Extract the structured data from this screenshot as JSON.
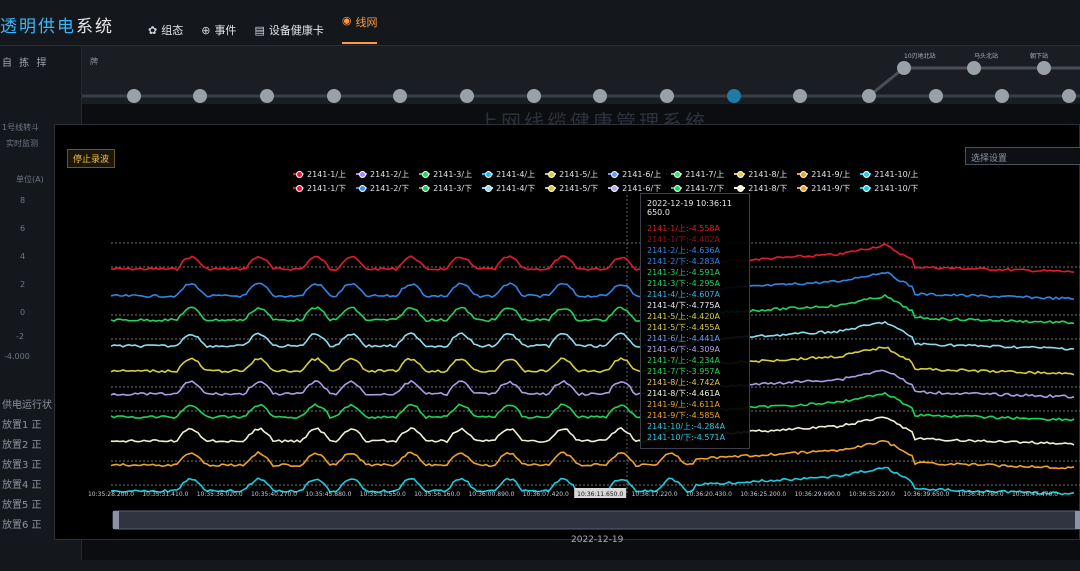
{
  "app": {
    "title_part1": "透明供电",
    "title_part2": "系统"
  },
  "nav": [
    {
      "icon": "gear-icon",
      "glyph": "✿",
      "label": "组态"
    },
    {
      "icon": "globe-icon",
      "glyph": "⊕",
      "label": "事件"
    },
    {
      "icon": "card-icon",
      "glyph": "▤",
      "label": "设备健康卡"
    },
    {
      "icon": "pin-icon",
      "glyph": "◉",
      "label": "线网"
    }
  ],
  "left_panel": {
    "header": "自 拣 捍",
    "sub1": "1号线转斗",
    "sub2": "实时监测",
    "ylabel": "单位(A)",
    "ticks": [
      "8",
      "6",
      "4",
      "2",
      "0",
      "-2",
      "-4.000"
    ],
    "list_header": "供电运行状",
    "list": [
      "放置1 正",
      "放置2 正",
      "放置3 正",
      "放置4 正",
      "放置5 正",
      "放置6 正"
    ]
  },
  "track": {
    "label": "牌",
    "station_names": [
      "10刃地北站",
      "马头北站",
      "朝下站"
    ]
  },
  "bg_title": "上网线缆健康管理系统",
  "popup": {
    "stop_button": "停止录波",
    "select_placeholder": "选择设置",
    "date_label": "2022-12-19"
  },
  "chart_data": {
    "type": "line",
    "x_ticks": [
      "10:35:28.200.0",
      "10:35:31.410.0",
      "10:35:36.020.0",
      "10:35:40.270.0",
      "10:35:45.880.0",
      "10:35:51.550.0",
      "10:35:56.160.0",
      "10:36:00.890.0",
      "10:36:07.420.0",
      "10:36:11.650.0",
      "10:36:17.220.0",
      "10:36:20.430.0",
      "10:36:25.200.0",
      "10:36:29.690.0",
      "10:36:35.220.0",
      "10:36:39.650.0",
      "10:36:43.780.0",
      "10:36:47.470.0"
    ],
    "highlight_tick_index": 9,
    "series": [
      {
        "name": "2141-1/上",
        "color": "#e8192c"
      },
      {
        "name": "2141-2/上",
        "color": "#a58cf0"
      },
      {
        "name": "2141-3/上",
        "color": "#22d35c"
      },
      {
        "name": "2141-4/上",
        "color": "#2fb6e8"
      },
      {
        "name": "2141-5/上",
        "color": "#d8cf3a"
      },
      {
        "name": "2141-6/上",
        "color": "#6a9ee8"
      },
      {
        "name": "2141-7/上",
        "color": "#3ee070"
      },
      {
        "name": "2141-8/上",
        "color": "#e4c65a"
      },
      {
        "name": "2141-9/上",
        "color": "#f0a22a"
      },
      {
        "name": "2141-10/上",
        "color": "#31c7e0"
      },
      {
        "name": "2141-1/下",
        "color": "#e8192c"
      },
      {
        "name": "2141-2/下",
        "color": "#3b8ef0"
      },
      {
        "name": "2141-3/下",
        "color": "#22c75c"
      },
      {
        "name": "2141-4/下",
        "color": "#8fdcf0"
      },
      {
        "name": "2141-5/下",
        "color": "#d4c938"
      },
      {
        "name": "2141-6/下",
        "color": "#b3a8ec"
      },
      {
        "name": "2141-7/下",
        "color": "#18d85a"
      },
      {
        "name": "2141-8/下",
        "color": "#f2f0d8"
      },
      {
        "name": "2141-9/下",
        "color": "#f0a22a"
      },
      {
        "name": "2141-10/下",
        "color": "#18cfe0"
      }
    ],
    "plotted_lines": [
      {
        "series": "2141-1/上",
        "color": "#e8192c"
      },
      {
        "series": "2141-2/下",
        "color": "#2f86e6"
      },
      {
        "series": "2141-3/上",
        "color": "#22d35c"
      },
      {
        "series": "2141-4/下",
        "color": "#8fdcf0"
      },
      {
        "series": "2141-5/上",
        "color": "#d8cf3a"
      },
      {
        "series": "2141-6/下",
        "color": "#a89de6"
      },
      {
        "series": "2141-7/上",
        "color": "#18d85a"
      },
      {
        "series": "2141-8/下",
        "color": "#f2f0d0"
      },
      {
        "series": "2141-9/上",
        "color": "#f0a22a"
      },
      {
        "series": "2141-10/下",
        "color": "#18cfe0"
      }
    ]
  },
  "tooltip": {
    "title": "2022-12-19 10:36:11 650.0",
    "rows": [
      {
        "text": "2141-1/上:-4.558A",
        "color": "#e8192c"
      },
      {
        "text": "2141-1/下:-4.402A",
        "color": "#8a1420"
      },
      {
        "text": "2141-2/上:-4.636A",
        "color": "#2f86e6"
      },
      {
        "text": "2141-2/下:-4.283A",
        "color": "#2f86e6"
      },
      {
        "text": "2141-3/上:-4.591A",
        "color": "#22d35c"
      },
      {
        "text": "2141-3/下:-4.295A",
        "color": "#22d35c"
      },
      {
        "text": "2141-4/上:-4.607A",
        "color": "#2fb6e8"
      },
      {
        "text": "2141-4/下:-4.775A",
        "color": "#e6e9ee"
      },
      {
        "text": "2141-5/上:-4.420A",
        "color": "#d8cf3a"
      },
      {
        "text": "2141-5/下:-4.455A",
        "color": "#d8cf3a"
      },
      {
        "text": "2141-6/上:-4.441A",
        "color": "#6a9ee8"
      },
      {
        "text": "2141-6/下:-4.309A",
        "color": "#b3a8ec"
      },
      {
        "text": "2141-7/上:-4.234A",
        "color": "#22d35c"
      },
      {
        "text": "2141-7/下:-3.957A",
        "color": "#22d35c"
      },
      {
        "text": "2141-8/上:-4.742A",
        "color": "#e4c65a"
      },
      {
        "text": "2141-8/下:-4.461A",
        "color": "#f2f0d8"
      },
      {
        "text": "2141-9/上:-4.611A",
        "color": "#f0a22a"
      },
      {
        "text": "2141-9/下:-4.585A",
        "color": "#f0a22a"
      },
      {
        "text": "2141-10/上:-4.284A",
        "color": "#31c7e0"
      },
      {
        "text": "2141-10/下:-4.571A",
        "color": "#31c7e0"
      }
    ]
  }
}
